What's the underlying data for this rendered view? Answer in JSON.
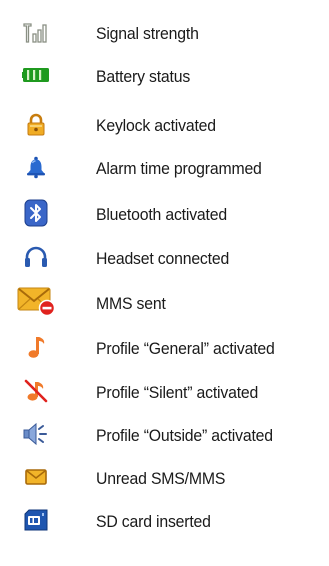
{
  "items": [
    {
      "icon": "signal-strength-icon",
      "label": "Signal strength"
    },
    {
      "icon": "battery-icon",
      "label": "Battery status"
    },
    {
      "icon": "padlock-icon",
      "label": "Keylock activated"
    },
    {
      "icon": "bell-icon",
      "label": "Alarm time programmed"
    },
    {
      "icon": "bluetooth-icon",
      "label": "Bluetooth activated"
    },
    {
      "icon": "headset-icon",
      "label": "Headset connected"
    },
    {
      "icon": "envelope-sent-icon",
      "label": "MMS sent"
    },
    {
      "icon": "music-note-icon",
      "label": "Profile “General” activated"
    },
    {
      "icon": "muted-note-icon",
      "label": "Profile “Silent” activated"
    },
    {
      "icon": "speaker-loud-icon",
      "label": "Profile “Outside” activated"
    },
    {
      "icon": "envelope-icon",
      "label": "Unread SMS/MMS"
    },
    {
      "icon": "sd-card-icon",
      "label": "SD card inserted"
    }
  ],
  "colors": {
    "text": "#1a1a1a",
    "signal": "#8a9084",
    "battery": "#1f9a1f",
    "padlock": "#e8a21a",
    "bell": "#2a6ad0",
    "bluetooth": "#3a66c8",
    "headset": "#2a5ab0",
    "envelope": "#f2b429",
    "alert_red": "#e0221e",
    "note": "#f07a2a",
    "speaker": "#6a8cc8",
    "sd_card": "#1f56b0"
  }
}
